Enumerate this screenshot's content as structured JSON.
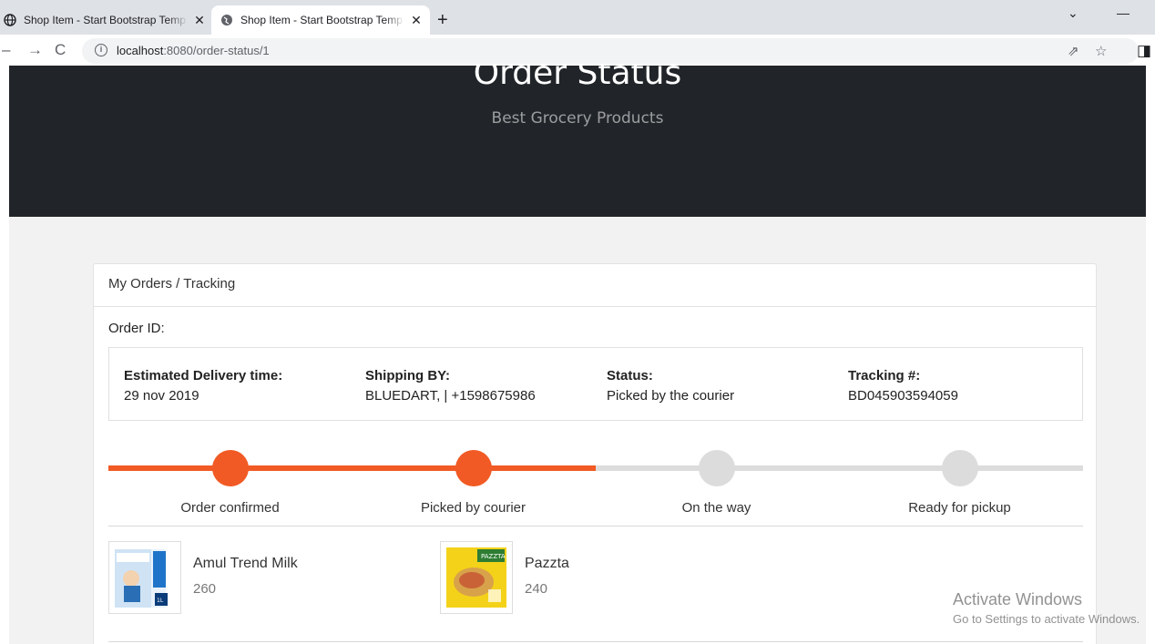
{
  "browser": {
    "tabs": [
      {
        "title": "Shop Item - Start Bootstrap Temp",
        "active": false,
        "icon": "globe-icon"
      },
      {
        "title": "Shop Item - Start Bootstrap Temp",
        "active": true,
        "icon": "globe-icon"
      }
    ],
    "url_host": "localhost",
    "url_rest": ":8080/order-status/1"
  },
  "hero": {
    "title": "Order Status",
    "subtitle": "Best Grocery Products"
  },
  "card": {
    "header": "My Orders / Tracking",
    "order_id_label": "Order ID:",
    "info": [
      {
        "label": "Estimated Delivery time:",
        "value": "29 nov 2019"
      },
      {
        "label": "Shipping BY:",
        "value": "BLUEDART, | +1598675986"
      },
      {
        "label": "Status:",
        "value": "Picked by the courier"
      },
      {
        "label": "Tracking #:",
        "value": "BD045903594059"
      }
    ],
    "steps": [
      {
        "label": "Order confirmed",
        "done": true
      },
      {
        "label": "Picked by courier",
        "done": true
      },
      {
        "label": "On the way",
        "done": false
      },
      {
        "label": "Ready for pickup",
        "done": false
      }
    ],
    "items": [
      {
        "name": "Amul Trend Milk",
        "price": "260"
      },
      {
        "name": "Pazzta",
        "price": "240"
      }
    ]
  },
  "colors": {
    "accent": "#f15a24",
    "inactive": "#dcdcdc",
    "hero_bg": "#212529"
  },
  "watermark": {
    "line1": "Activate Windows",
    "line2": "Go to Settings to activate Windows."
  }
}
